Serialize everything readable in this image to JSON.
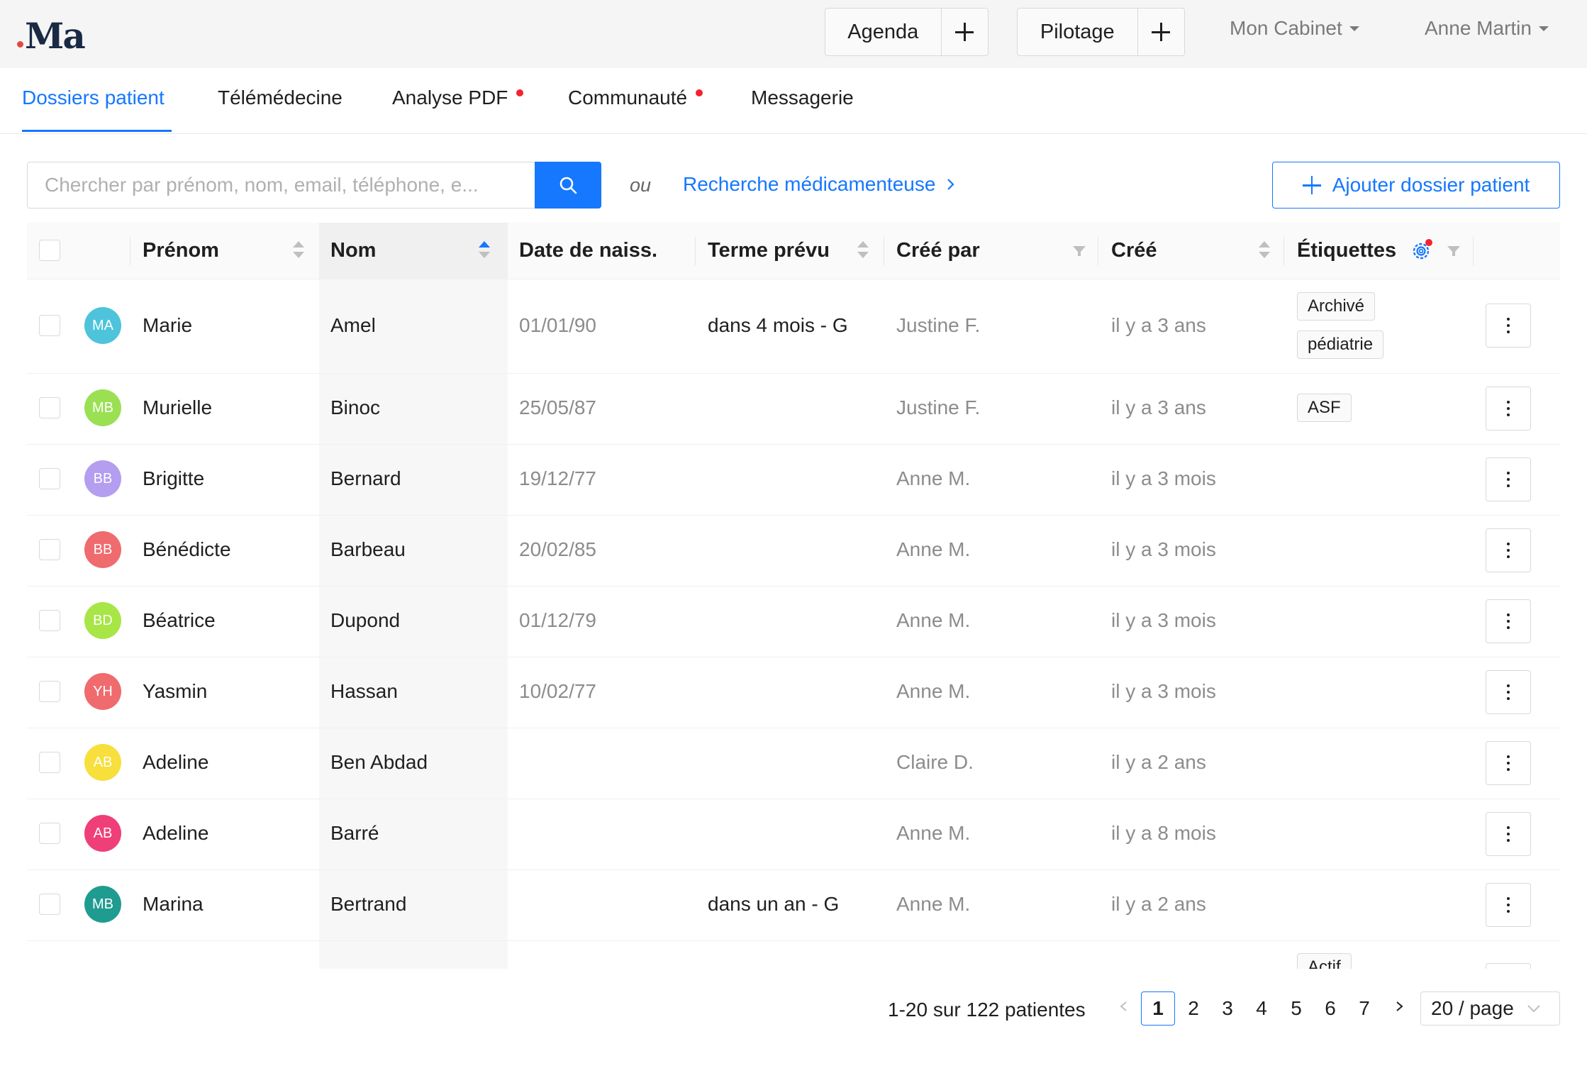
{
  "header": {
    "logo": "Ma",
    "agenda_label": "Agenda",
    "pilotage_label": "Pilotage",
    "cabinet_label": "Mon Cabinet",
    "user_label": "Anne Martin"
  },
  "tabs": [
    {
      "label": "Dossiers patient",
      "active": true,
      "badge": false
    },
    {
      "label": "Télémédecine",
      "active": false,
      "badge": false
    },
    {
      "label": "Analyse PDF",
      "active": false,
      "badge": true
    },
    {
      "label": "Communauté",
      "active": false,
      "badge": true
    },
    {
      "label": "Messagerie",
      "active": false,
      "badge": false
    }
  ],
  "search": {
    "placeholder": "Chercher par prénom, nom, email, téléphone, e...",
    "value": "",
    "or_label": "ou",
    "med_search_label": "Recherche médicamenteuse",
    "add_patient_label": "Ajouter dossier patient"
  },
  "table": {
    "columns": {
      "prenom": "Prénom",
      "nom": "Nom",
      "naissance": "Date de naiss.",
      "terme": "Terme prévu",
      "cree_par": "Créé par",
      "cree": "Créé",
      "etiquettes": "Étiquettes"
    },
    "rows": [
      {
        "initials": "MA",
        "color": "#4dc4db",
        "prenom": "Marie",
        "nom": "Amel",
        "naissance": "01/01/90",
        "terme": "dans 4 mois - G",
        "cree_par": "Justine F.",
        "cree": "il y a 3 ans",
        "tags": [
          "Archivé",
          "pédiatrie"
        ]
      },
      {
        "initials": "MB",
        "color": "#9be053",
        "prenom": "Murielle",
        "nom": "Binoc",
        "naissance": "25/05/87",
        "terme": "",
        "cree_par": "Justine F.",
        "cree": "il y a 3 ans",
        "tags": [
          "ASF"
        ]
      },
      {
        "initials": "BB",
        "color": "#b39ef0",
        "prenom": "Brigitte",
        "nom": "Bernard",
        "naissance": "19/12/77",
        "terme": "",
        "cree_par": "Anne M.",
        "cree": "il y a 3 mois",
        "tags": []
      },
      {
        "initials": "BB",
        "color": "#ef6b6e",
        "prenom": "Bénédicte",
        "nom": "Barbeau",
        "naissance": "20/02/85",
        "terme": "",
        "cree_par": "Anne M.",
        "cree": "il y a 3 mois",
        "tags": []
      },
      {
        "initials": "BD",
        "color": "#a7e646",
        "prenom": "Béatrice",
        "nom": "Dupond",
        "naissance": "01/12/79",
        "terme": "",
        "cree_par": "Anne M.",
        "cree": "il y a 3 mois",
        "tags": []
      },
      {
        "initials": "YH",
        "color": "#ef6b6e",
        "prenom": "Yasmin",
        "nom": "Hassan",
        "naissance": "10/02/77",
        "terme": "",
        "cree_par": "Anne M.",
        "cree": "il y a 3 mois",
        "tags": []
      },
      {
        "initials": "AB",
        "color": "#f7df3c",
        "prenom": "Adeline",
        "nom": "Ben Abdad",
        "naissance": "",
        "terme": "",
        "cree_par": "Claire D.",
        "cree": "il y a 2 ans",
        "tags": []
      },
      {
        "initials": "AB",
        "color": "#ef3f79",
        "prenom": "Adeline",
        "nom": "Barré",
        "naissance": "",
        "terme": "",
        "cree_par": "Anne M.",
        "cree": "il y a 8 mois",
        "tags": []
      },
      {
        "initials": "MB",
        "color": "#1f9c8f",
        "prenom": "Marina",
        "nom": "Bertrand",
        "naissance": "",
        "terme": "dans un an - G",
        "cree_par": "Anne M.",
        "cree": "il y a 2 ans",
        "tags": []
      }
    ],
    "partial_row_tag": "Actif"
  },
  "pagination": {
    "total_label": "1-20 sur 122 patientes",
    "pages": [
      "1",
      "2",
      "3",
      "4",
      "5",
      "6",
      "7"
    ],
    "current": "1",
    "page_size_label": "20 / page"
  },
  "colors": {
    "accent": "#1677ff",
    "badge_red": "#f5222d",
    "logo_navy": "#1b2a44"
  }
}
